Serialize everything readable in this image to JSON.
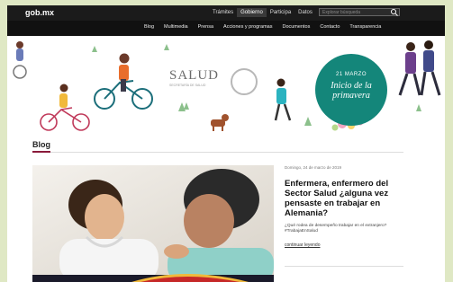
{
  "header": {
    "logo": "gob.mx",
    "nav": [
      {
        "label": "Trámites"
      },
      {
        "label": "Gobierno"
      },
      {
        "label": "Participa"
      },
      {
        "label": "Datos"
      }
    ],
    "search_placeholder": "Explorar búsqueda"
  },
  "subnav": [
    {
      "label": "Blog"
    },
    {
      "label": "Multimedia"
    },
    {
      "label": "Prensa"
    },
    {
      "label": "Acciones y programas"
    },
    {
      "label": "Documentos"
    },
    {
      "label": "Contacto"
    },
    {
      "label": "Transparencia"
    }
  ],
  "banner": {
    "logo_text": "SALUD",
    "logo_sub": "SECRETARÍA DE SALUD",
    "circle_date": "21 MARZO",
    "circle_title": "Inicio de la primavera"
  },
  "blog": {
    "heading": "Blog",
    "article": {
      "date": "Domingo, 24 de marzo de 2019",
      "title": "Enfermera, enfermero del Sector Salud ¿alguna vez pensaste en trabajar en Alemania?",
      "summary": "¿Qué rodea de desempeño trabajar en el extranjero? #TrabajaEnSalud",
      "link": "continuar leyendo"
    }
  },
  "colors": {
    "topbar": "#1b1b1b",
    "accent": "#14867a",
    "blog_accent": "#8a1a3a"
  }
}
